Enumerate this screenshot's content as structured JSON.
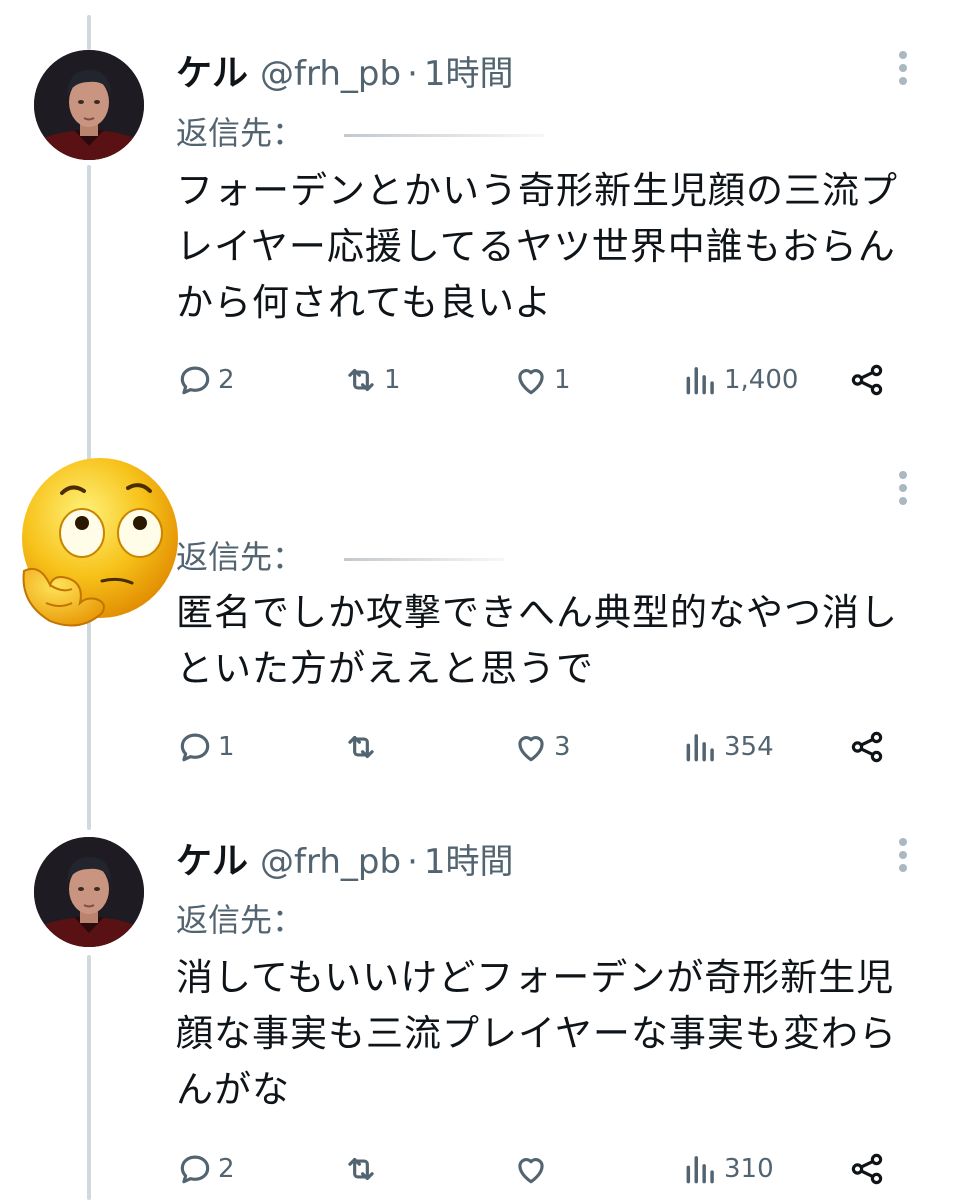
{
  "tweets": [
    {
      "name": "ケル",
      "handle": "@frh_pb",
      "separator": "·",
      "time": "1時間",
      "reply_label": "返信先：",
      "text": "フォーデンとかいう奇形新生児顔の三流プレイヤー応援してるヤツ世界中誰もおらんから何されても良いよ",
      "actions": {
        "replies": "2",
        "retweets": "1",
        "likes": "1",
        "views": "1,400"
      }
    },
    {
      "name": "",
      "handle": "",
      "separator": "",
      "time": "",
      "reply_label": "返信先：",
      "text": "匿名でしか攻撃できへん典型的なやつ消しといた方がええと思うで",
      "actions": {
        "replies": "1",
        "retweets": "",
        "likes": "3",
        "views": "354"
      }
    },
    {
      "name": "ケル",
      "handle": "@frh_pb",
      "separator": "·",
      "time": "1時間",
      "reply_label": "返信先：",
      "text": "消してもいいけどフォーデンが奇形新生児顔な事実も三流プレイヤーな事実も変わらんがな",
      "actions": {
        "replies": "2",
        "retweets": "",
        "likes": "",
        "views": "310"
      }
    }
  ],
  "icons": {
    "reply": "reply-icon",
    "retweet": "retweet-icon",
    "like": "heart-icon",
    "views": "views-chart-icon",
    "share": "share-icon",
    "more": "more-vertical-icon",
    "emoji": "thinking-face-emoji"
  },
  "colors": {
    "text": "#0f1419",
    "secondary": "#536471",
    "thread_line": "#cfd9de",
    "emoji": "#f5b700"
  }
}
